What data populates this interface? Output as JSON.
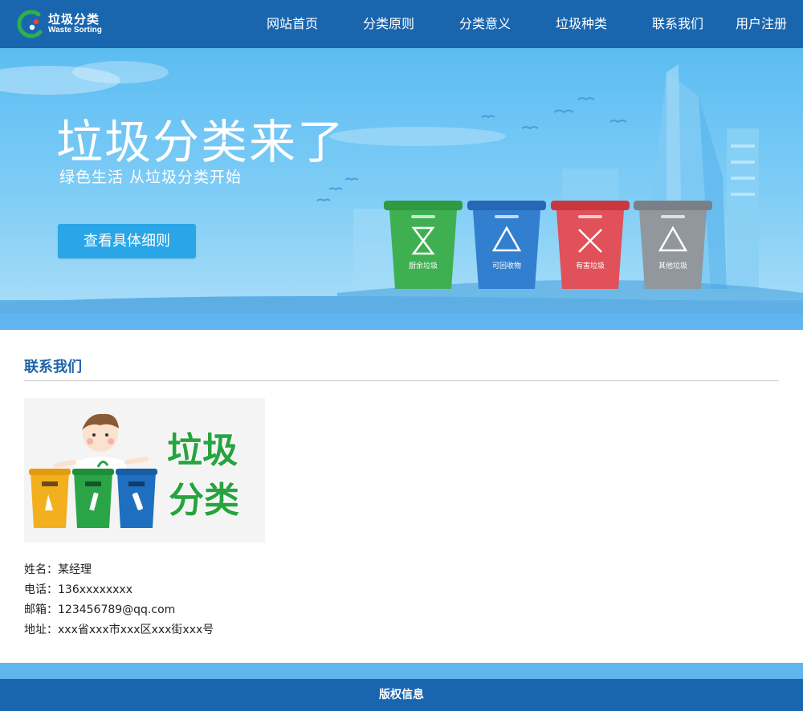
{
  "header": {
    "logo_cn": "垃圾分类",
    "logo_en": "Waste Sorting",
    "nav": [
      "网站首页",
      "分类原则",
      "分类意义",
      "垃圾种类",
      "联系我们",
      "用户注册"
    ]
  },
  "banner": {
    "title": "垃圾分类来了",
    "subtitle": "绿色生活 从垃圾分类开始",
    "button": "查看具体细则",
    "bins": [
      {
        "label": "厨余垃圾",
        "color": "#3aa84a"
      },
      {
        "label": "可回收物",
        "color": "#2f77c9"
      },
      {
        "label": "有害垃圾",
        "color": "#d9434b"
      },
      {
        "label": "其他垃圾",
        "color": "#8a8f96"
      }
    ]
  },
  "contact": {
    "title": "联系我们",
    "image_text": [
      "垃圾",
      "分类"
    ],
    "rows": [
      "姓名：某经理",
      "电话：136xxxxxxxx",
      "邮箱：123456789@qq.com",
      "地址：xxx省xxx市xxx区xxx街xxx号"
    ]
  },
  "footer": {
    "text": "版权信息"
  },
  "colors": {
    "primary": "#1a66ae",
    "accent": "#61b5ee",
    "button": "#2aa6e6",
    "title": "#1e62a8"
  }
}
